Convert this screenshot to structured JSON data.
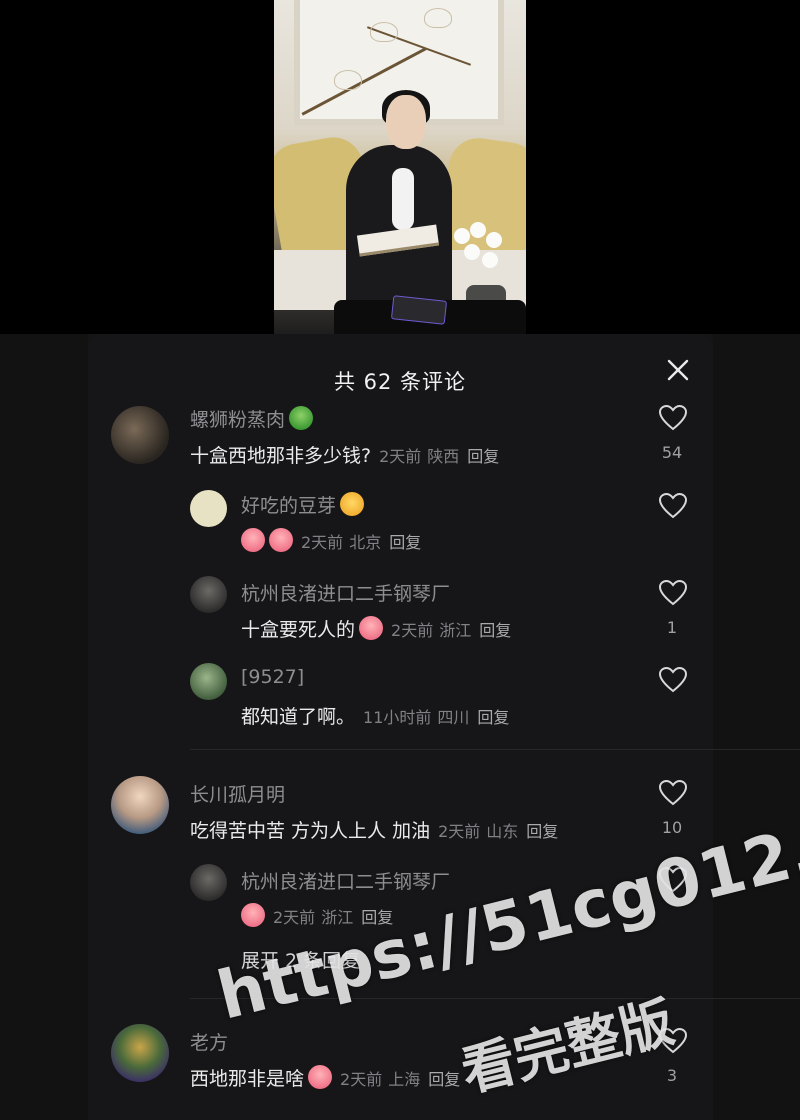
{
  "sheet": {
    "title": "共 62 条评论"
  },
  "comments": [
    {
      "name": "螺狮粉蒸肉",
      "name_emoji": "green-face",
      "text": "十盒西地那非多少钱?",
      "time": "2天前",
      "location": "陕西",
      "reply": "回复",
      "likes": "54"
    },
    {
      "name": "好吃的豆芽",
      "name_emoji": "smile",
      "text": "",
      "time": "2天前",
      "location": "北京",
      "reply": "回复",
      "likes": ""
    },
    {
      "name": "杭州良渚进口二手钢琴厂",
      "text": "十盒要死人的",
      "time": "2天前",
      "location": "浙江",
      "reply": "回复",
      "likes": "1"
    },
    {
      "name": "[9527]",
      "text": "都知道了啊。",
      "time": "11小时前",
      "location": "四川",
      "reply": "回复",
      "likes": ""
    },
    {
      "name": "长川孤月明",
      "text": "吃得苦中苦 方为人上人 加油",
      "time": "2天前",
      "location": "山东",
      "reply": "回复",
      "likes": "10"
    },
    {
      "name": "杭州良渚进口二手钢琴厂",
      "text": "",
      "time": "2天前",
      "location": "浙江",
      "reply": "回复",
      "likes": ""
    },
    {
      "name": "老方",
      "text": "西地那非是啥",
      "time": "2天前",
      "location": "上海",
      "reply": "回复",
      "likes": "3"
    }
  ],
  "expand_replies": "展开 2 条回复",
  "watermark": {
    "line1": "https://51cg012.com",
    "line2": "看完整版"
  },
  "colors": {
    "background": "#000000",
    "sheet": "#161618",
    "name": "#8d8d92",
    "text": "#eaeaea"
  }
}
